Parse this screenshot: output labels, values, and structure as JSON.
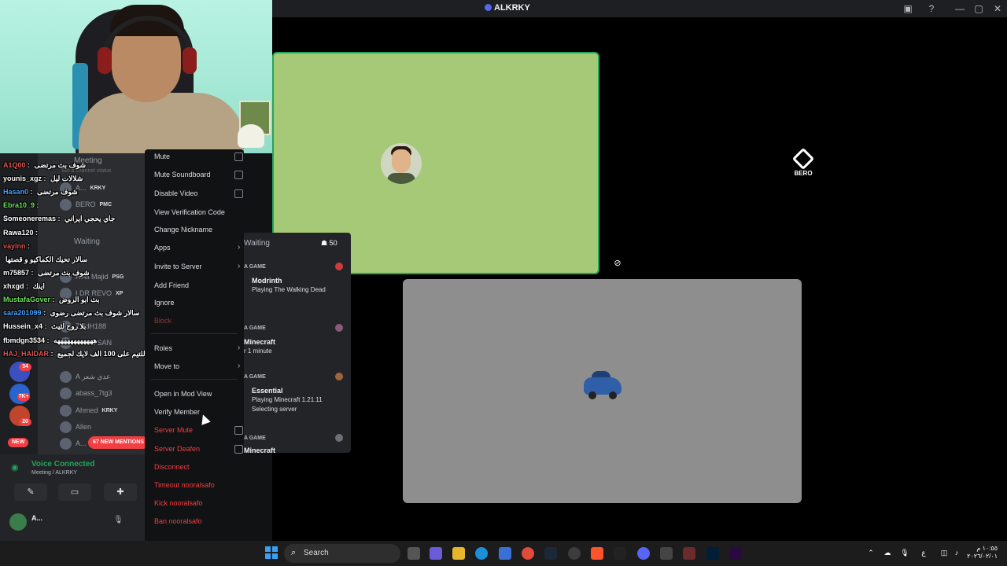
{
  "window": {
    "title": "ALKRKY",
    "minimize": "—",
    "maximize": "▢",
    "close": "✕",
    "inbox_icon": "inbox-icon",
    "help_icon": "?"
  },
  "stage": {
    "tile_right_label": "BERO"
  },
  "chat": [
    {
      "user": "A1Q00",
      "color": "#e05353",
      "msg": "شوف بث مرتضى"
    },
    {
      "user": "younis_xgz",
      "color": "#ffffff",
      "msg": "شلالات ليل"
    },
    {
      "user": "Hasan0",
      "color": "#4aa3ff",
      "msg": "شوف مرتضى"
    },
    {
      "user": "Ebra10_9",
      "color": "#6ee35c",
      "msg": ""
    },
    {
      "user": "Someoneremas",
      "color": "#ffffff",
      "msg": "جاي يحجي ايراني"
    },
    {
      "user": "Rawa120",
      "color": "#ffffff",
      "msg": ""
    },
    {
      "user": "vayinn",
      "color": "#e05353",
      "msg": ""
    },
    {
      "user": "",
      "color": "#e05353",
      "msg": "سالار تحيك الكماكيو و قصتها"
    },
    {
      "user": "m75857",
      "color": "#ffffff",
      "msg": "شوف بث مرتضى"
    },
    {
      "user": "xhxgd",
      "color": "#ffffff",
      "msg": "اينك"
    },
    {
      "user": "MustafaGover",
      "color": "#6ee35c",
      "msg": "بث ابو الروض"
    },
    {
      "user": "sara201099",
      "color": "#4aa3ff",
      "msg": "سالار شوف بث مرتضى رضوى"
    },
    {
      "user": "Hussein_x4",
      "color": "#ffffff",
      "msg": "بلا روح لثيث"
    },
    {
      "user": "fbmdgn3534",
      "color": "#ffffff",
      "msg": "ههههههههههههه"
    },
    {
      "user": "HAJ_HAIDAR",
      "color": "#e05353",
      "msg": "ابو كرك مرتضى يبارك للتيم على 100 الف لايك لجميع"
    }
  ],
  "sidebar": {
    "channel_meeting": "Meeting",
    "channel_status_hint": "Set a channel status",
    "channel_waiting": "Waiting",
    "members": [
      {
        "name": "A...",
        "tag": "KRKY"
      },
      {
        "name": "BERO",
        "tag": "PMC"
      },
      {
        "name": "A Ali Majid",
        "tag": "PSG"
      },
      {
        "name": "I DR REVO",
        "tag": "XP"
      },
      {
        "name": "ZaidH188",
        "tag": ""
      },
      {
        "name": "ADER SAN",
        "tag": ""
      },
      {
        "name": "A عدي شعر",
        "tag": ""
      },
      {
        "name": "abass_7tg3",
        "tag": ""
      },
      {
        "name": "Ahmed",
        "tag": "KRKY"
      },
      {
        "name": "Allen",
        "tag": ""
      },
      {
        "name": "A...",
        "tag": ""
      }
    ],
    "rail_badges": [
      "34",
      "7K+",
      "20"
    ],
    "new_pill": "NEW",
    "new_mentions": "67 NEW MENTIONS",
    "voice_connected": "Voice Connected",
    "voice_channel": "Meeting / ALKRKY",
    "user_name": "A..."
  },
  "activity": {
    "waiting": "Waiting",
    "count": "50",
    "sections": [
      {
        "head": "A GAME",
        "title": "Modrinth",
        "sub": "Playing The Walking Dead",
        "sub2": ""
      },
      {
        "head": "A GAME",
        "title": "Minecraft",
        "sub": "r 1 minute",
        "sub2": ""
      },
      {
        "head": "A GAME",
        "title": "Essential",
        "sub": "Playing Minecraft 1.21.11",
        "sub2": "Selecting server"
      },
      {
        "head": "A GAME",
        "title": "Minecraft",
        "sub": "",
        "sub2": ""
      }
    ]
  },
  "menu": {
    "items": [
      {
        "label": "Mute",
        "kind": "check"
      },
      {
        "label": "Mute Soundboard",
        "kind": "check"
      },
      {
        "label": "Disable Video",
        "kind": "check"
      },
      {
        "label": "View Verification Code",
        "kind": "plain"
      },
      {
        "label": "Change Nickname",
        "kind": "plain"
      },
      {
        "label": "Apps",
        "kind": "sub"
      },
      {
        "label": "Invite to Server",
        "kind": "sub"
      },
      {
        "label": "Add Friend",
        "kind": "plain"
      },
      {
        "label": "Ignore",
        "kind": "plain"
      },
      {
        "label": "Block",
        "kind": "dim"
      },
      {
        "label": "Roles",
        "kind": "sub"
      },
      {
        "label": "Move to",
        "kind": "sub"
      },
      {
        "label": "Open in Mod View",
        "kind": "plain"
      },
      {
        "label": "Verify Member",
        "kind": "plain"
      },
      {
        "label": "Server Mute",
        "kind": "danger-check"
      },
      {
        "label": "Server Deafen",
        "kind": "danger-check"
      },
      {
        "label": "Disconnect",
        "kind": "danger"
      },
      {
        "label": "Timeout nooralsafo",
        "kind": "danger"
      },
      {
        "label": "Kick nooralsafo",
        "kind": "danger"
      },
      {
        "label": "Ban nooralsafo",
        "kind": "danger"
      }
    ]
  },
  "taskbar": {
    "search_label": "Search",
    "time": "١٠:٥٥ م",
    "date": "٢٠٢٦/٠٢/٠١",
    "lang": "ع"
  }
}
